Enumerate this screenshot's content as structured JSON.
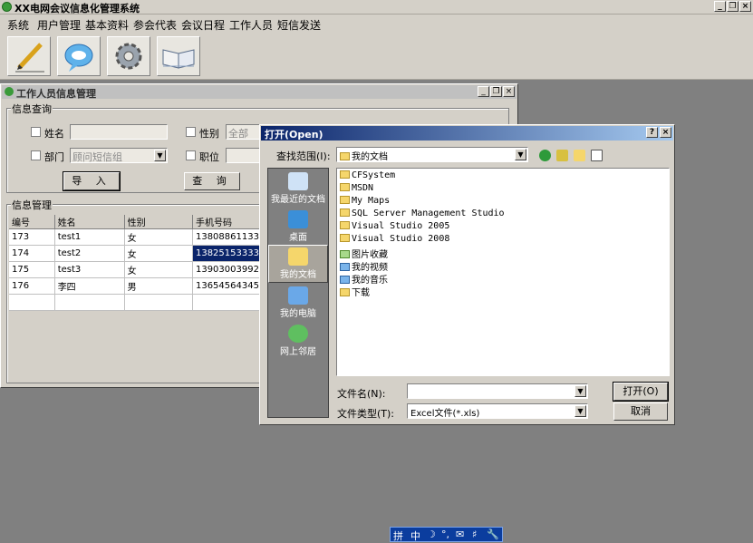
{
  "app": {
    "title": "XX电网会议信息化管理系统"
  },
  "window_controls": {
    "minimize": "_",
    "restore": "❐",
    "close": "×"
  },
  "menu": [
    "系统",
    "用户管理",
    "基本资料",
    "参会代表",
    "会议日程",
    "工作人员",
    "短信发送"
  ],
  "toolbar": {
    "buttons": [
      {
        "icon": "pencil-icon"
      },
      {
        "icon": "chat-bubble-icon"
      },
      {
        "icon": "gear-icon"
      },
      {
        "icon": "book-icon"
      }
    ]
  },
  "child_window": {
    "title": "工作人员信息管理",
    "query_group": {
      "legend": "信息查询",
      "name_label": "姓名",
      "gender_label": "性别",
      "gender_value": "全部",
      "dept_label": "部门",
      "dept_value": "顾问短信组",
      "position_label": "职位",
      "import_button": "导 入",
      "search_button": "查 询"
    },
    "manage_group": {
      "legend": "信息管理",
      "columns": [
        "编号",
        "姓名",
        "性别",
        "手机号码"
      ],
      "rows": [
        [
          "173",
          "test1",
          "女",
          "13808861133"
        ],
        [
          "174",
          "test2",
          "女",
          "13825153333"
        ],
        [
          "175",
          "test3",
          "女",
          "13903003992"
        ],
        [
          "176",
          "李四",
          "男",
          "13654564345"
        ]
      ]
    }
  },
  "open_dialog": {
    "title": "打开(Open)",
    "help": "?",
    "close": "×",
    "look_in_label": "查找范围(I):",
    "look_in_value": "我的文档",
    "places": [
      "我最近的文档",
      "桌面",
      "我的文档",
      "我的电脑",
      "网上邻居"
    ],
    "files": [
      {
        "name": "CFSystem",
        "type": "folder"
      },
      {
        "name": "MSDN",
        "type": "folder"
      },
      {
        "name": "My Maps",
        "type": "folder"
      },
      {
        "name": "SQL Server Management Studio",
        "type": "folder"
      },
      {
        "name": "Visual Studio 2005",
        "type": "folder"
      },
      {
        "name": "Visual Studio 2008",
        "type": "folder"
      },
      {
        "name": "图片收藏",
        "type": "pictures"
      },
      {
        "name": "我的视频",
        "type": "videos"
      },
      {
        "name": "我的音乐",
        "type": "music"
      },
      {
        "name": "下载",
        "type": "folder"
      }
    ],
    "filename_label": "文件名(N):",
    "filename_value": "",
    "filetype_label": "文件类型(T):",
    "filetype_value": "Excel文件(*.xls)",
    "open_button": "打开(O)",
    "cancel_button": "取消"
  },
  "ime_bar": [
    "拼",
    "中",
    "☽",
    "°,",
    "✉",
    "♯",
    "🔧"
  ]
}
